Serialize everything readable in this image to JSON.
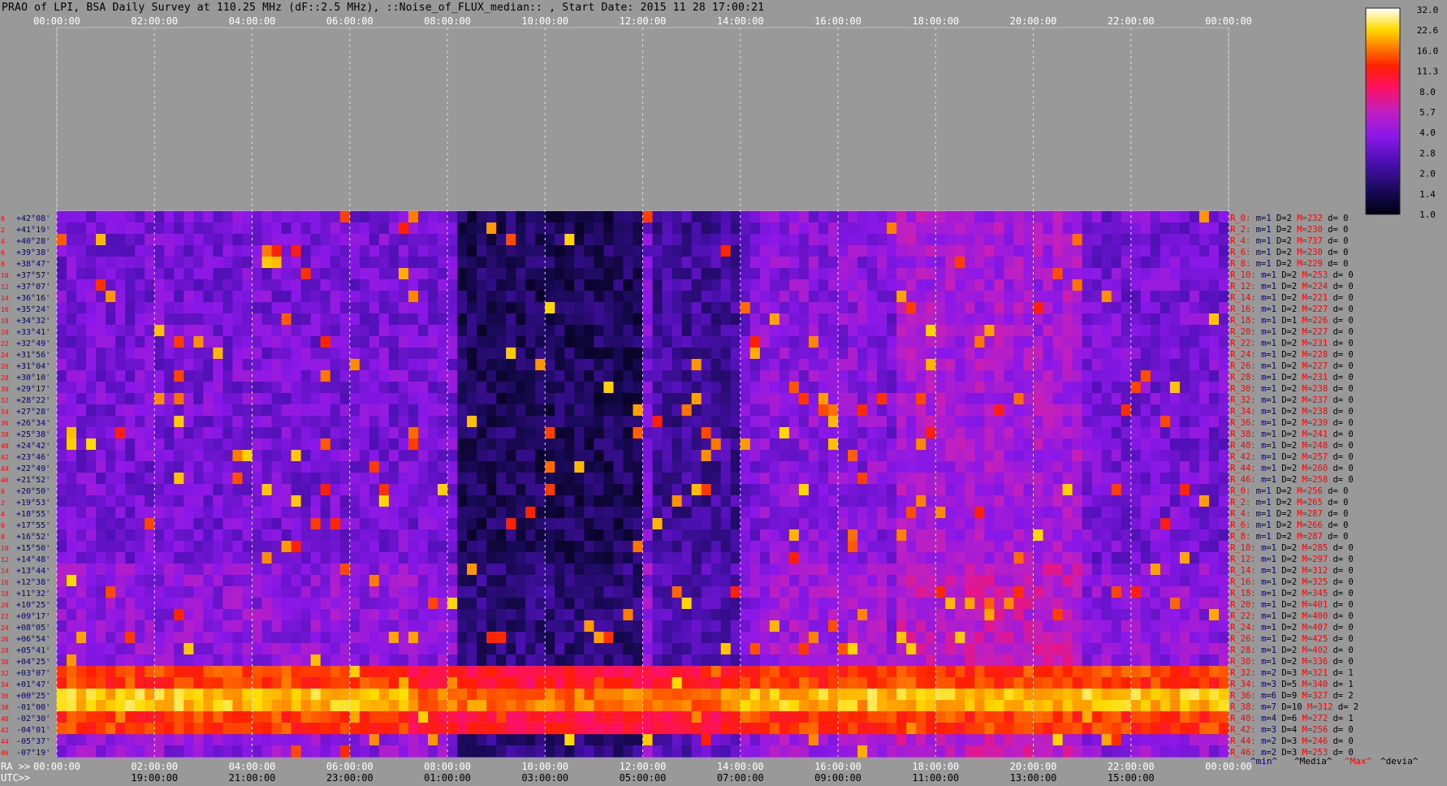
{
  "title": "PRAO of LPI, BSA Daily Survey at 110.25 MHz (dF::2.5 MHz), ::Noise_of_FLUX_median:: , Start Date: 2015 11 28 17:00:21",
  "colors": {
    "background": "#999999",
    "stat_m": "#000080",
    "stat_dev": "#000000",
    "stat_max": "#ff0000",
    "row_label": "#ff0000",
    "dec_label": "#000080"
  },
  "top_axis_ticks": [
    "00:00:00",
    "02:00:00",
    "04:00:00",
    "06:00:00",
    "08:00:00",
    "10:00:00",
    "12:00:00",
    "14:00:00",
    "16:00:00",
    "18:00:00",
    "20:00:00",
    "22:00:00",
    "00:00:00"
  ],
  "bottom_ra_prefix": "RA >>",
  "bottom_utc_prefix": "UTC>>",
  "bottom_ra_ticks": [
    "00:00:00",
    "02:00:00",
    "04:00:00",
    "06:00:00",
    "08:00:00",
    "10:00:00",
    "12:00:00",
    "14:00:00",
    "16:00:00",
    "18:00:00",
    "20:00:00",
    "22:00:00",
    "00:00:00"
  ],
  "bottom_utc_ticks": [
    "19:00:00",
    "21:00:00",
    "23:00:00",
    "01:00:00",
    "03:00:00",
    "05:00:00",
    "07:00:00",
    "09:00:00",
    "11:00:00",
    "13:00:00",
    "15:00:00"
  ],
  "stats_footer": {
    "min": "^min^",
    "median": "^Media^",
    "max": "^Max^",
    "dev": "^devia^"
  },
  "colorbar_ticks": [
    "32.0",
    "22.6",
    "16.0",
    "11.3",
    "8.0",
    "5.7",
    "4.0",
    "2.8",
    "2.0",
    "1.4",
    "1.0"
  ],
  "chart_data": {
    "type": "heatmap",
    "title": "PRAO of LPI, BSA Daily Survey at 110.25 MHz (dF::2.5 MHz), ::Noise_of_FLUX_median:: , Start Date: 2015 11 28 17:00:21",
    "x_axis_top": "RA 00:00:00 to 00:00:00",
    "colorbar_range": [
      1.0,
      32.0
    ],
    "colorbar_scale": "log",
    "rows": [
      {
        "n": "0",
        "dec": "+42°08'",
        "r": "R_0:",
        "m": 1,
        "D": 2,
        "M": 232,
        "d": 0
      },
      {
        "n": "2",
        "dec": "+41°19'",
        "r": "R_2:",
        "m": 1,
        "D": 2,
        "M": 230,
        "d": 0
      },
      {
        "n": "4",
        "dec": "+40°28'",
        "r": "R_4:",
        "m": 1,
        "D": 2,
        "M": 737,
        "d": 0
      },
      {
        "n": "6",
        "dec": "+39°38'",
        "r": "R_6:",
        "m": 1,
        "D": 2,
        "M": 230,
        "d": 0
      },
      {
        "n": "8",
        "dec": "+38°47'",
        "r": "R_8:",
        "m": 1,
        "D": 2,
        "M": 229,
        "d": 0
      },
      {
        "n": "10",
        "dec": "+37°57'",
        "r": "R_10:",
        "m": 1,
        "D": 2,
        "M": 253,
        "d": 0
      },
      {
        "n": "12",
        "dec": "+37°07'",
        "r": "R_12:",
        "m": 1,
        "D": 2,
        "M": 224,
        "d": 0
      },
      {
        "n": "14",
        "dec": "+36°16'",
        "r": "R_14:",
        "m": 1,
        "D": 2,
        "M": 221,
        "d": 0
      },
      {
        "n": "16",
        "dec": "+35°24'",
        "r": "R_16:",
        "m": 1,
        "D": 2,
        "M": 227,
        "d": 0
      },
      {
        "n": "18",
        "dec": "+34°32'",
        "r": "R_18:",
        "m": 1,
        "D": 1,
        "M": 226,
        "d": 0
      },
      {
        "n": "20",
        "dec": "+33°41'",
        "r": "R_20:",
        "m": 1,
        "D": 2,
        "M": 227,
        "d": 0
      },
      {
        "n": "22",
        "dec": "+32°49'",
        "r": "R_22:",
        "m": 1,
        "D": 2,
        "M": 231,
        "d": 0
      },
      {
        "n": "24",
        "dec": "+31°56'",
        "r": "R_24:",
        "m": 1,
        "D": 2,
        "M": 228,
        "d": 0
      },
      {
        "n": "26",
        "dec": "+31°04'",
        "r": "R_26:",
        "m": 1,
        "D": 2,
        "M": 227,
        "d": 0
      },
      {
        "n": "28",
        "dec": "+30°10'",
        "r": "R_28:",
        "m": 1,
        "D": 2,
        "M": 231,
        "d": 0
      },
      {
        "n": "30",
        "dec": "+29°17'",
        "r": "R_30:",
        "m": 1,
        "D": 2,
        "M": 238,
        "d": 0
      },
      {
        "n": "32",
        "dec": "+28°22'",
        "r": "R_32:",
        "m": 1,
        "D": 2,
        "M": 237,
        "d": 0
      },
      {
        "n": "34",
        "dec": "+27°28'",
        "r": "R_34:",
        "m": 1,
        "D": 2,
        "M": 238,
        "d": 0
      },
      {
        "n": "36",
        "dec": "+26°34'",
        "r": "R_36:",
        "m": 1,
        "D": 2,
        "M": 239,
        "d": 0
      },
      {
        "n": "38",
        "dec": "+25°38'",
        "r": "R_38:",
        "m": 1,
        "D": 2,
        "M": 241,
        "d": 0
      },
      {
        "n": "40",
        "dec": "+24°42'",
        "r": "R_40:",
        "m": 1,
        "D": 2,
        "M": 248,
        "d": 0
      },
      {
        "n": "42",
        "dec": "+23°46'",
        "r": "R_42:",
        "m": 1,
        "D": 2,
        "M": 257,
        "d": 0
      },
      {
        "n": "44",
        "dec": "+22°49'",
        "r": "R_44:",
        "m": 1,
        "D": 2,
        "M": 260,
        "d": 0
      },
      {
        "n": "46",
        "dec": "+21°52'",
        "r": "R_46:",
        "m": 1,
        "D": 2,
        "M": 258,
        "d": 0
      },
      {
        "n": "0",
        "dec": "+20°50'",
        "r": "R_0:",
        "m": 1,
        "D": 2,
        "M": 256,
        "d": 0
      },
      {
        "n": "2",
        "dec": "+19°53'",
        "r": "R_2:",
        "m": 1,
        "D": 2,
        "M": 265,
        "d": 0
      },
      {
        "n": "4",
        "dec": "+18°55'",
        "r": "R_4:",
        "m": 1,
        "D": 2,
        "M": 287,
        "d": 0
      },
      {
        "n": "6",
        "dec": "+17°55'",
        "r": "R_6:",
        "m": 1,
        "D": 2,
        "M": 266,
        "d": 0
      },
      {
        "n": "8",
        "dec": "+16°52'",
        "r": "R_8:",
        "m": 1,
        "D": 2,
        "M": 287,
        "d": 0
      },
      {
        "n": "10",
        "dec": "+15°50'",
        "r": "R_10:",
        "m": 1,
        "D": 2,
        "M": 285,
        "d": 0
      },
      {
        "n": "12",
        "dec": "+14°48'",
        "r": "R_12:",
        "m": 1,
        "D": 2,
        "M": 297,
        "d": 0
      },
      {
        "n": "14",
        "dec": "+13°44'",
        "r": "R_14:",
        "m": 1,
        "D": 2,
        "M": 312,
        "d": 0
      },
      {
        "n": "16",
        "dec": "+12°38'",
        "r": "R_16:",
        "m": 1,
        "D": 2,
        "M": 325,
        "d": 0
      },
      {
        "n": "18",
        "dec": "+11°32'",
        "r": "R_18:",
        "m": 1,
        "D": 2,
        "M": 345,
        "d": 0
      },
      {
        "n": "20",
        "dec": "+10°25'",
        "r": "R_20:",
        "m": 1,
        "D": 2,
        "M": 401,
        "d": 0
      },
      {
        "n": "22",
        "dec": "+09°17'",
        "r": "R_22:",
        "m": 1,
        "D": 2,
        "M": 400,
        "d": 0
      },
      {
        "n": "24",
        "dec": "+08°05'",
        "r": "R_24:",
        "m": 1,
        "D": 2,
        "M": 407,
        "d": 0
      },
      {
        "n": "26",
        "dec": "+06°54'",
        "r": "R_26:",
        "m": 1,
        "D": 2,
        "M": 425,
        "d": 0
      },
      {
        "n": "28",
        "dec": "+05°41'",
        "r": "R_28:",
        "m": 1,
        "D": 2,
        "M": 402,
        "d": 0
      },
      {
        "n": "30",
        "dec": "+04°25'",
        "r": "R_30:",
        "m": 1,
        "D": 2,
        "M": 336,
        "d": 0
      },
      {
        "n": "32",
        "dec": "+03°07'",
        "r": "R_32:",
        "m": 2,
        "D": 3,
        "M": 321,
        "d": 1
      },
      {
        "n": "34",
        "dec": "+01°47'",
        "r": "R_34:",
        "m": 3,
        "D": 5,
        "M": 340,
        "d": 1
      },
      {
        "n": "36",
        "dec": "+00°25'",
        "r": "R_36:",
        "m": 6,
        "D": 9,
        "M": 327,
        "d": 2
      },
      {
        "n": "38",
        "dec": "-01°00'",
        "r": "R_38:",
        "m": 7,
        "D": 10,
        "M": 312,
        "d": 2
      },
      {
        "n": "40",
        "dec": "-02°30'",
        "r": "R_40:",
        "m": 4,
        "D": 6,
        "M": 272,
        "d": 1
      },
      {
        "n": "42",
        "dec": "-04°01'",
        "r": "R_42:",
        "m": 3,
        "D": 4,
        "M": 256,
        "d": 0
      },
      {
        "n": "44",
        "dec": "-05°37'",
        "r": "R_44:",
        "m": 2,
        "D": 3,
        "M": 246,
        "d": 0
      },
      {
        "n": "46",
        "dec": "-07°19'",
        "r": "R_46:",
        "m": 2,
        "D": 3,
        "M": 253,
        "d": 0
      }
    ]
  }
}
